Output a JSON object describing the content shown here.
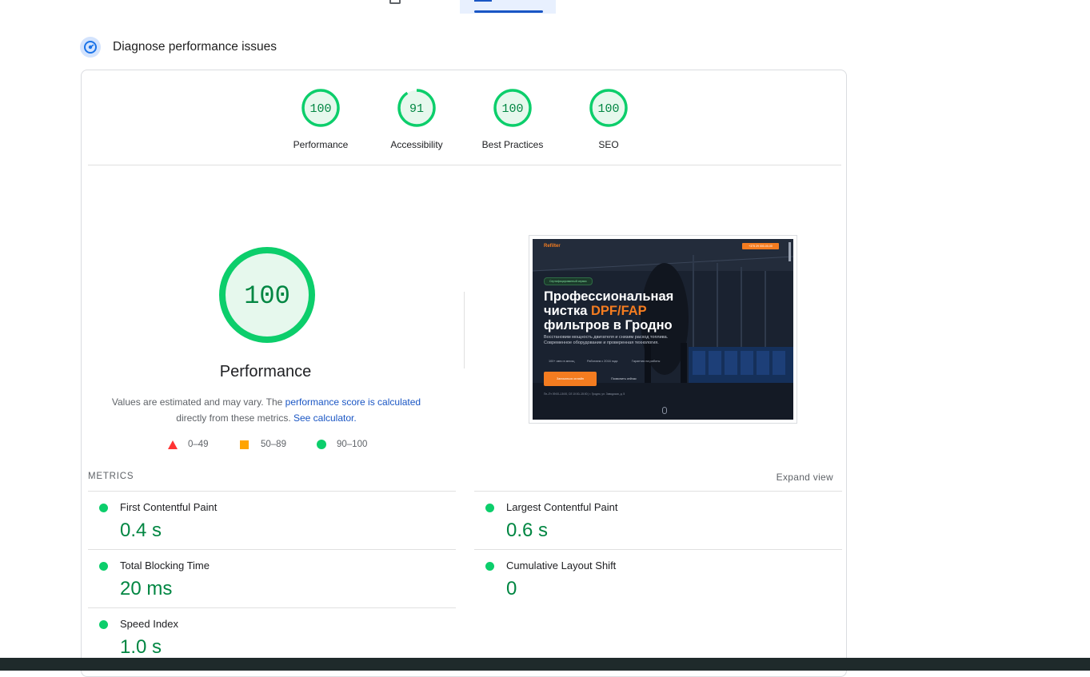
{
  "header": {
    "title": "Diagnose performance issues"
  },
  "scores": [
    {
      "label": "Performance",
      "value": "100",
      "score": 100
    },
    {
      "label": "Accessibility",
      "value": "91",
      "score": 91
    },
    {
      "label": "Best Practices",
      "value": "100",
      "score": 100
    },
    {
      "label": "SEO",
      "value": "100",
      "score": 100
    }
  ],
  "performance": {
    "score": "100",
    "title": "Performance",
    "note_prefix": "Values are estimated and may vary. The ",
    "note_link1": "performance score is calculated",
    "note_middle": "directly from these metrics. ",
    "note_link2": "See calculator."
  },
  "legend": [
    {
      "range": "0–49",
      "shape": "triangle",
      "color": "#ff3333"
    },
    {
      "range": "50–89",
      "shape": "square",
      "color": "#ffa400"
    },
    {
      "range": "90–100",
      "shape": "circle",
      "color": "#0cce6b"
    }
  ],
  "screenshot": {
    "logo": "Refilter",
    "badge": "Сертифицированный сервис",
    "heading_line1": "Профессиональная",
    "heading_line2a": "чистка ",
    "heading_line2b": "DPF/FAP",
    "heading_line3": "фильтров в Гродно",
    "subtext": "Восстановим мощность двигателя и снизим расход топлива. Современное оборудование и проверенная технология.",
    "stat1": "100+ авто в месяц",
    "stat2": "Работаем с 2016 года",
    "stat3": "Гарантия на работы",
    "cta_primary": "Записаться онлайн",
    "cta_secondary": "Позвонить сейчас",
    "phone_btn": "+375 29 000-00-00",
    "footer": "Пн–Пт 09:00–18:00, Сб 10:00–15:00 | г. Гродно, ул. Заводская, д. 5"
  },
  "metrics": {
    "label": "METRICS",
    "expand": "Expand view",
    "items": [
      {
        "name": "First Contentful Paint",
        "value": "0.4 s"
      },
      {
        "name": "Largest Contentful Paint",
        "value": "0.6 s"
      },
      {
        "name": "Total Blocking Time",
        "value": "20 ms"
      },
      {
        "name": "Cumulative Layout Shift",
        "value": "0"
      },
      {
        "name": "Speed Index",
        "value": "1.0 s"
      }
    ]
  },
  "colors": {
    "pass": "#0cce6b",
    "pass_bg": "#e6f8ed",
    "pass_text": "#018642",
    "link": "#1a56c4",
    "orange": "#f47c20"
  }
}
